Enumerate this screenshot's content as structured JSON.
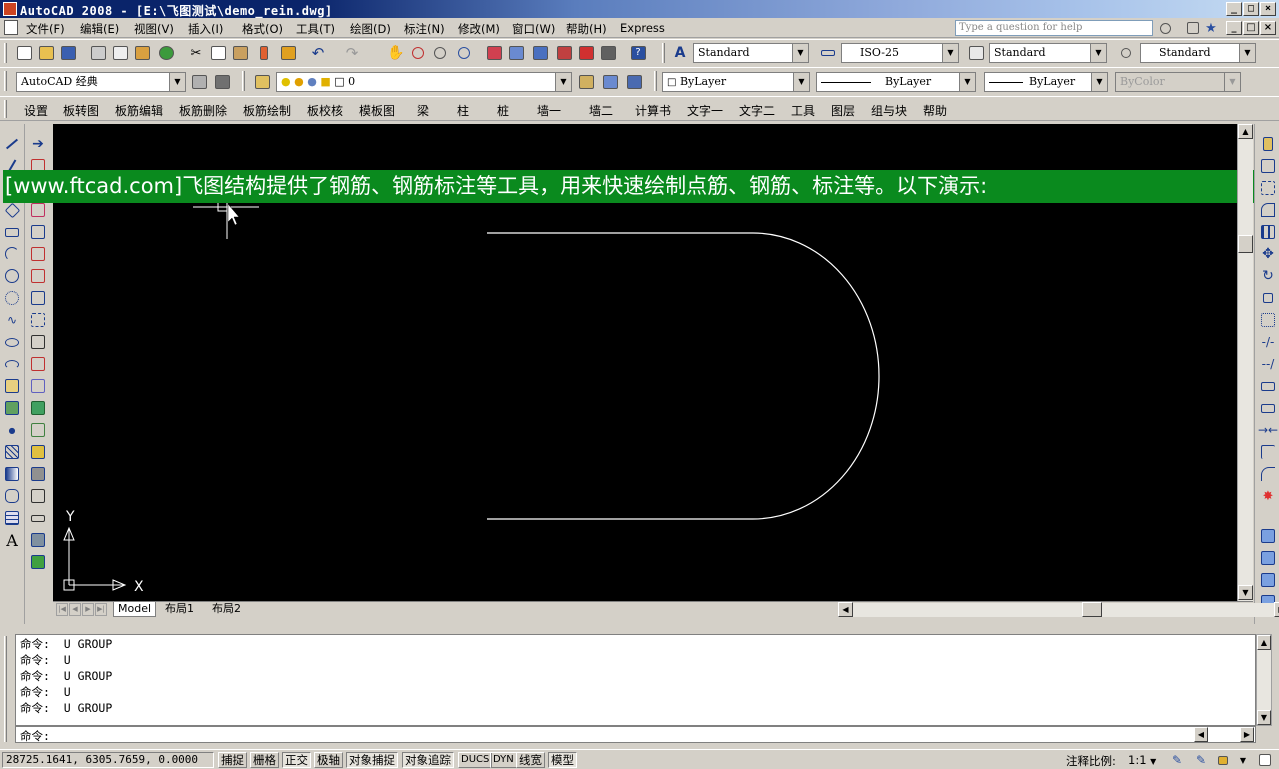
{
  "window": {
    "title": "AutoCAD 2008 - [E:\\飞图测试\\demo_rein.dwg]"
  },
  "menubar": {
    "items": [
      "文件(F)",
      "编辑(E)",
      "视图(V)",
      "插入(I)",
      "格式(O)",
      "工具(T)",
      "绘图(D)",
      "标注(N)",
      "修改(M)",
      "窗口(W)",
      "帮助(H)",
      "Express"
    ],
    "help_placeholder": "Type a question for help"
  },
  "toolbar_styles": {
    "text_style": "Standard",
    "dim_style": "ISO-25",
    "table_style": "Standard",
    "mleader_style": "Standard"
  },
  "toolbar_layers": {
    "workspace": "AutoCAD 经典",
    "layer": "0",
    "color": "ByLayer",
    "linetype": "ByLayer",
    "lineweight": "ByLayer",
    "plotstyle": "ByColor"
  },
  "plugin_menu": {
    "items": [
      "设置",
      "板转图",
      "板筋编辑",
      "板筋删除",
      "板筋绘制",
      "板校核",
      "模板图",
      "梁",
      "柱",
      "桩",
      "墙一",
      "墙二",
      "计算书",
      "文字一",
      "文字二",
      "工具",
      "图层",
      "组与块",
      "帮助"
    ]
  },
  "banner": {
    "text": "[www.ftcad.com]飞图结构提供了钢筋、钢筋标注等工具，用来快速绘制点筋、钢筋、标注等。以下演示:"
  },
  "ucs": {
    "x_label": "X",
    "y_label": "Y"
  },
  "layout_tabs": [
    "Model",
    "布局1",
    "布局2"
  ],
  "command_history": [
    {
      "prompt": "命令:",
      "text": "U GROUP"
    },
    {
      "prompt": "命令:",
      "text": "U"
    },
    {
      "prompt": "命令:",
      "text": "U GROUP"
    },
    {
      "prompt": "命令:",
      "text": "U"
    },
    {
      "prompt": "命令:",
      "text": "U GROUP"
    }
  ],
  "command_prompt": "命令:",
  "statusbar": {
    "coords": "28725.1641, 6305.7659, 0.0000",
    "toggles": [
      "捕捉",
      "栅格",
      "正交",
      "极轴",
      "对象捕捉",
      "对象追踪",
      "DUCS",
      "DYN",
      "线宽",
      "模型"
    ],
    "annotation_scale_label": "注释比例:",
    "annotation_scale": "1:1"
  }
}
